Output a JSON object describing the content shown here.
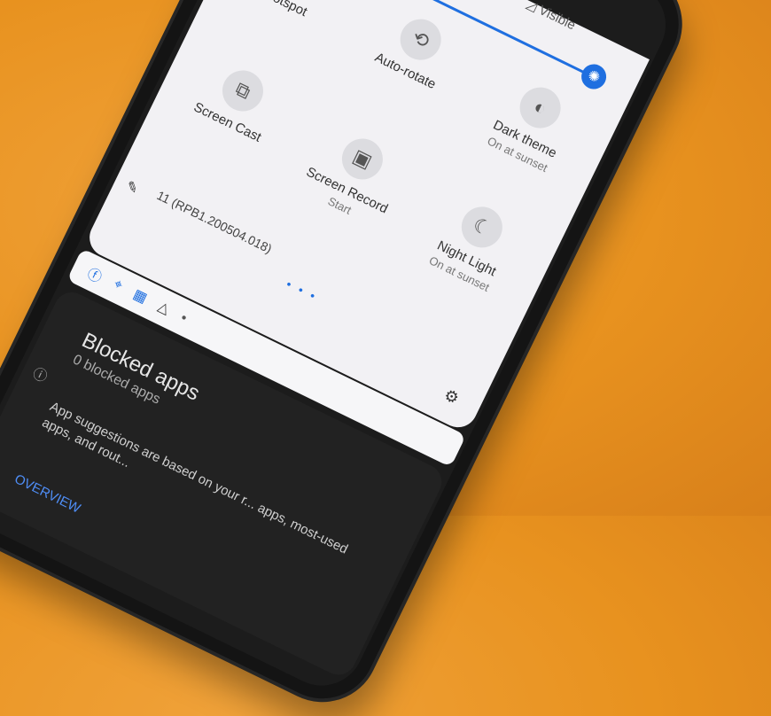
{
  "status": {
    "visible": "Visible"
  },
  "tiles": [
    {
      "label": "Hotspot",
      "icon": "hotspot-icon"
    },
    {
      "label": "Auto-rotate",
      "icon": "auto-rotate-icon"
    },
    {
      "label": "Dark theme",
      "sublabel": "On at sunset",
      "icon": "dark-theme-icon"
    },
    {
      "label": "Screen Cast",
      "icon": "screen-cast-icon"
    },
    {
      "label": "Screen Record",
      "sublabel": "Start",
      "icon": "screen-record-icon"
    },
    {
      "label": "Night Light",
      "sublabel": "On at sunset",
      "icon": "night-light-icon"
    }
  ],
  "footer": {
    "build": "11 (RPB1.200504.018)"
  },
  "background_sheet": {
    "blocked_title": "Blocked apps",
    "blocked_sub": "0 blocked apps",
    "suggestions": "App suggestions are based on your r... apps, most-used apps, and rout...",
    "overview": "OVERVIEW"
  },
  "colors": {
    "accent": "#1f6fe0",
    "panel": "#f2f1f4",
    "background": "#e8921f"
  }
}
